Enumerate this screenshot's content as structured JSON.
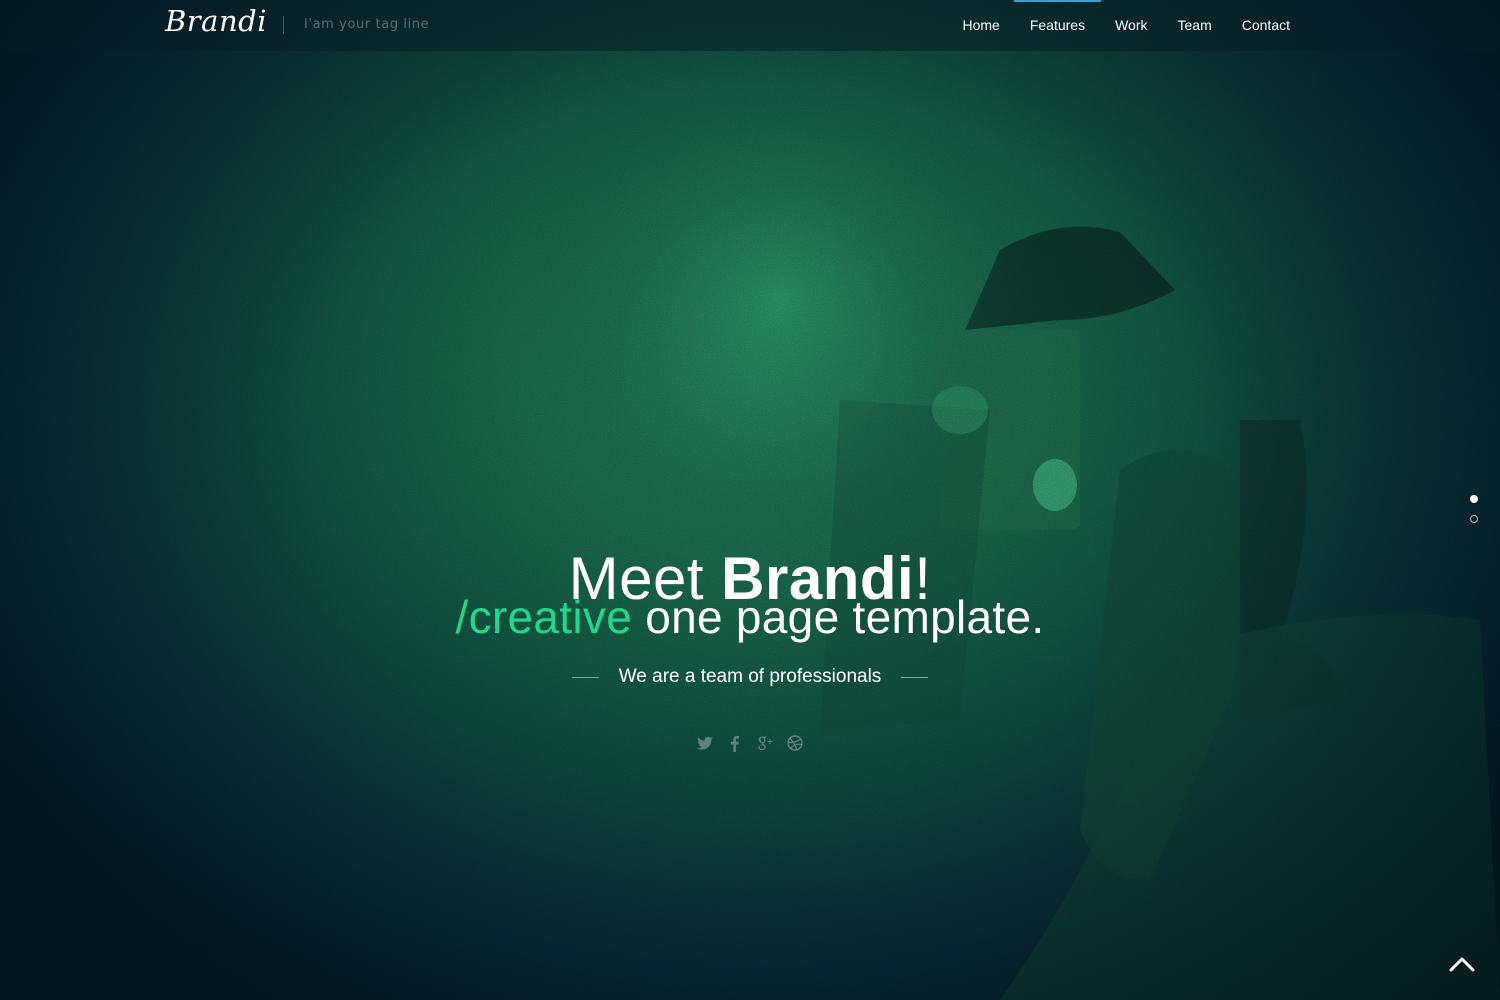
{
  "brand": {
    "logo": "Brandi",
    "tagline": "I'am your tag line"
  },
  "nav": {
    "items": [
      {
        "label": "Home"
      },
      {
        "label": "Features",
        "active": true
      },
      {
        "label": "Work"
      },
      {
        "label": "Team"
      },
      {
        "label": "Contact"
      }
    ]
  },
  "hero": {
    "title_prefix": "Meet ",
    "title_brand": "Brandi",
    "title_suffix": "!",
    "subtitle_accent": "/creative",
    "subtitle_rest": " one page template.",
    "tagline": "We are a team of professionals"
  },
  "social": {
    "icons": [
      "twitter-icon",
      "facebook-icon",
      "google-plus-icon",
      "dribbble-icon"
    ]
  },
  "slider": {
    "count": 2,
    "active_index": 0
  },
  "colors": {
    "accent": "#22d68c",
    "nav_active_bar": "#2aa6d8",
    "text": "#ffffff"
  }
}
